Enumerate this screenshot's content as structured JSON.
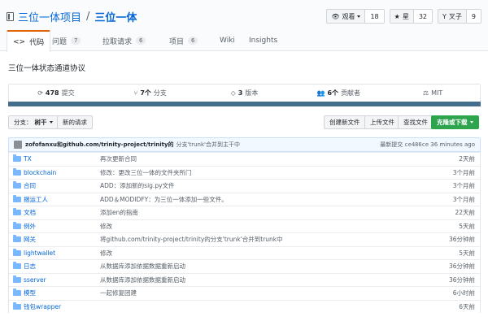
{
  "repo": {
    "owner": "三位一体项目",
    "separator": "/",
    "name": "三位一体"
  },
  "actions": [
    {
      "label": "观看",
      "count": "18",
      "icon": "eye-icon"
    },
    {
      "label": "星",
      "count": "32",
      "icon": "star-icon"
    },
    {
      "label": "叉子",
      "count": "9",
      "icon": "fork-icon"
    }
  ],
  "tabs": [
    {
      "label": "代码",
      "badge": ""
    },
    {
      "label": "问题",
      "badge": "7"
    },
    {
      "label": "拉取请求",
      "badge": "6"
    },
    {
      "label": "项目",
      "badge": "6"
    },
    {
      "label": "Wiki",
      "badge": ""
    },
    {
      "label": "Insights",
      "badge": ""
    }
  ],
  "description": "三位一体状态通道协议",
  "summary": [
    {
      "icon": "commits-icon",
      "count": "478",
      "label": "提交"
    },
    {
      "icon": "branch-icon",
      "count": "7个",
      "label": "分支"
    },
    {
      "icon": "tag-icon",
      "count": "3",
      "label": "版本"
    },
    {
      "icon": "contributors-icon",
      "count": "6个",
      "label": "贡献者"
    },
    {
      "icon": "license-icon",
      "count": "",
      "label": "MIT"
    }
  ],
  "language_bar_color": "#436f8c",
  "file_nav": {
    "branch_prefix": "分支：",
    "branch_value": "树干",
    "new_pr": "新的请求",
    "create_file": "创建新文件",
    "upload_files": "上传文件",
    "find_file": "查找文件",
    "clone": "克隆或下载"
  },
  "latest_commit": {
    "author": "zofofanxu和github.com/trinity-project/trinity的",
    "message": "分支'trunk'合并到主干中",
    "prefix": "最新提交",
    "sha": "ce486ce",
    "age": "36 minutes ago"
  },
  "files": [
    {
      "name": "TX",
      "message": "再次更新合同",
      "age": "2天前"
    },
    {
      "name": "blockchain",
      "message": "修改：更改三位一体的文件夹所门",
      "age": "3个月前"
    },
    {
      "name": "合同",
      "message": "ADD：添加新的sig.py文件",
      "age": "3个月前"
    },
    {
      "name": "捆运工人",
      "message": "ADD＆MODIDFY：为三位一体添加一些文件。",
      "age": "3个月前"
    },
    {
      "name": "文档",
      "message": "添加en的指南",
      "age": "22天前"
    },
    {
      "name": "例外",
      "message": "修改",
      "age": "5天前"
    },
    {
      "name": "网关",
      "message": "将github.com/trinity-project/trinity的分支'trunk'合并到trunk中",
      "age": "36分钟前"
    },
    {
      "name": "lightwallet",
      "message": "修改",
      "age": "5天前"
    },
    {
      "name": "日志",
      "message": "从数据库添加依据数据重新启动",
      "age": "36分钟前"
    },
    {
      "name": "sserver",
      "message": "从数据库添加依据数据重新启动",
      "age": "36分钟前"
    },
    {
      "name": "模型",
      "message": "一起修复团建",
      "age": "6小时前"
    },
    {
      "name": "钱包wrapper",
      "message": "",
      "age": "6天前"
    }
  ]
}
